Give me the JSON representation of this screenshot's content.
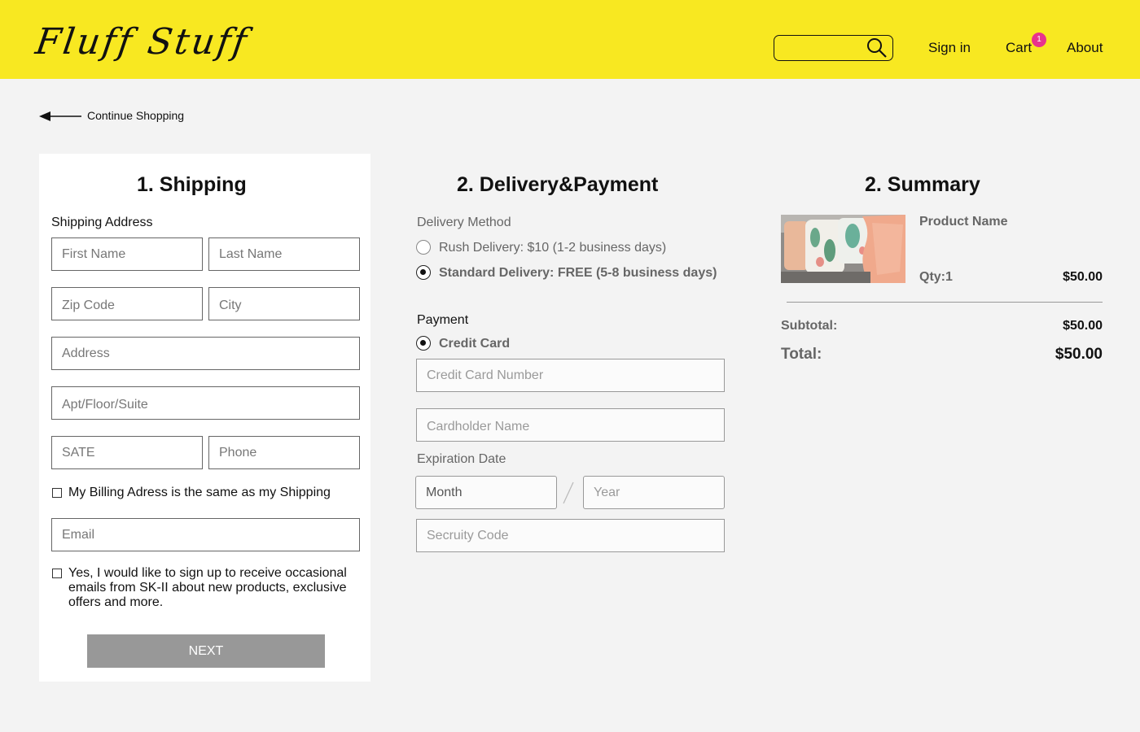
{
  "header": {
    "logo": "Fluff Stuff",
    "search_placeholder": "",
    "nav": {
      "sign_in": "Sign in",
      "cart": "Cart",
      "cart_count": "1",
      "about": "About"
    }
  },
  "back": {
    "label": "Continue Shopping"
  },
  "shipping": {
    "title": "1. Shipping",
    "address_label": "Shipping Address",
    "fields": {
      "first_name": "First Name",
      "last_name": "Last Name",
      "zip": "Zip Code",
      "city": "City",
      "address": "Address",
      "apt": "Apt/Floor/Suite",
      "state": "SATE",
      "phone": "Phone",
      "email": "Email"
    },
    "billing_same": "My Billing Adress is the same as my Shipping",
    "newsletter": "Yes, I would like to sign up to receive occasional emails from SK-II about new products, exclusive offers and more.",
    "next_label": "NEXT"
  },
  "delivery": {
    "title": "2. Delivery&Payment",
    "method_label": "Delivery Method",
    "options": [
      {
        "label": "Rush Delivery: $10 (1-2 business days)",
        "selected": false
      },
      {
        "label": "Standard Delivery: FREE (5-8 business days)",
        "selected": true
      }
    ],
    "payment_label": "Payment",
    "payment_option": "Credit Card",
    "card_number": "Credit Card Number",
    "cardholder": "Cardholder Name",
    "expiration_label": "Expiration Date",
    "month": "Month",
    "year": "Year",
    "security": "Secruity Code"
  },
  "summary": {
    "title": "2. Summary",
    "product_name": "Product Name",
    "qty": "Qty:1",
    "price": "$50.00",
    "subtotal_label": "Subtotal:",
    "subtotal": "$50.00",
    "total_label": "Total:",
    "total": "$50.00"
  },
  "colors": {
    "header_bg": "#f8e821",
    "badge": "#e8338d",
    "next_button": "#989898"
  }
}
